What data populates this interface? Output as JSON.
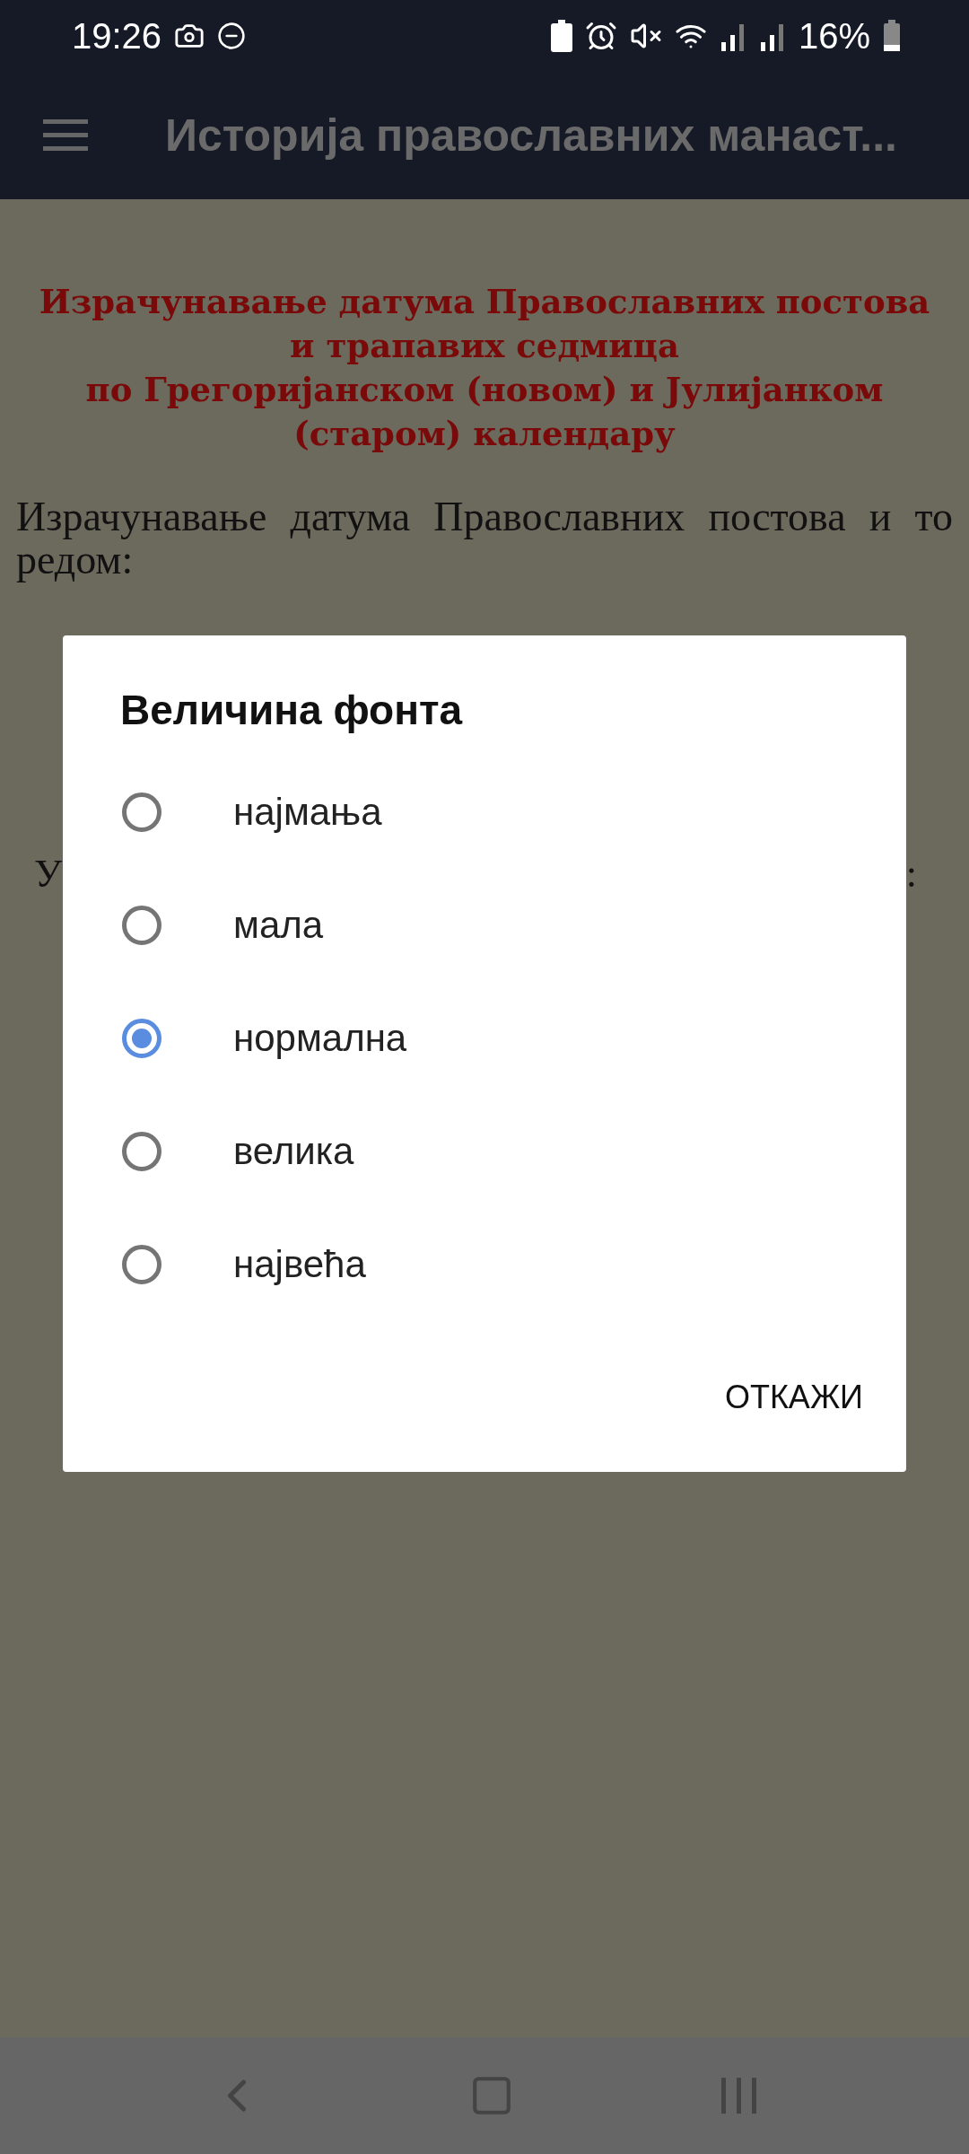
{
  "status_bar": {
    "time": "19:26",
    "battery": "16%"
  },
  "app_bar": {
    "title": "Историја православних манаст..."
  },
  "content": {
    "heading": [
      "Израчунавање датума Православних постова",
      "и трапавих седмица",
      "по Грегоријанском (новом) и Јулијанком",
      "(старом) календару"
    ],
    "paragraph": "Израчунавање датума Православних постова и то редом:",
    "hidden_line": {
      "start": "У",
      "end": ":"
    }
  },
  "dialog": {
    "title": "Величина фонта",
    "options": [
      {
        "label": "најмања",
        "selected": false
      },
      {
        "label": "мала",
        "selected": false
      },
      {
        "label": "нормална",
        "selected": true
      },
      {
        "label": "велика",
        "selected": false
      },
      {
        "label": "највећа",
        "selected": false
      }
    ],
    "cancel": "ОТКАЖИ"
  }
}
